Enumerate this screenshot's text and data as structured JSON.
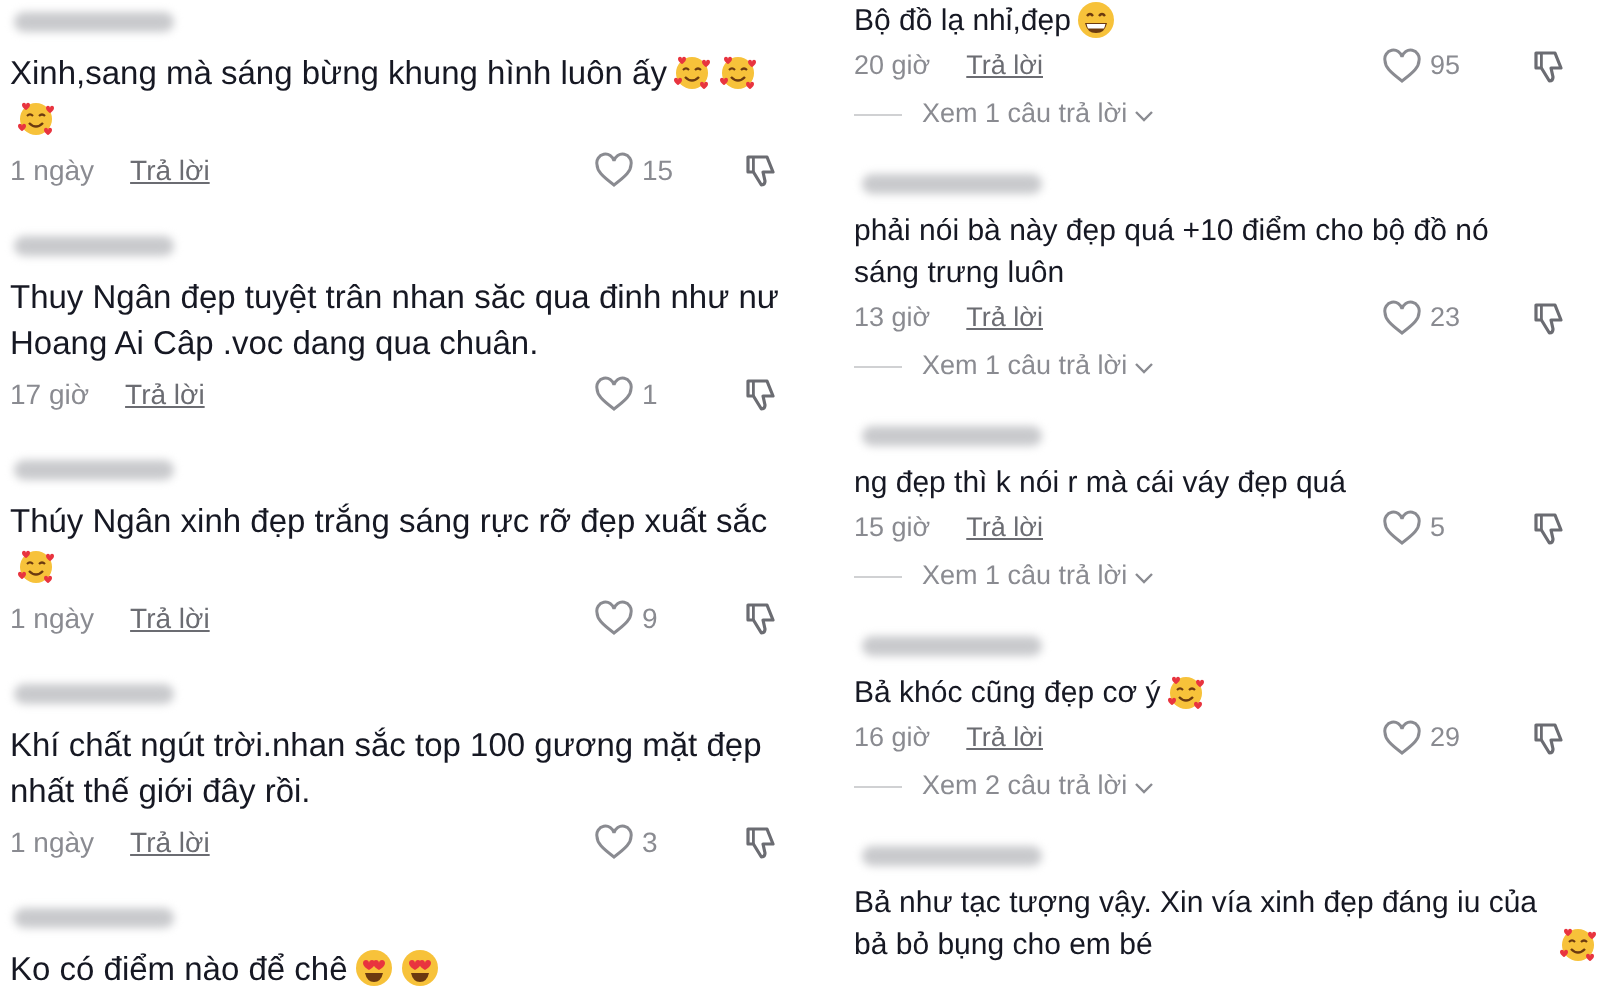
{
  "left_panel": {
    "comments": [
      {
        "author": {
          "blurred": true
        },
        "text": "Xinh,sang mà sáng bừng khung hình luôn ấy",
        "emojis": [
          {
            "kind": "smiling-hearts"
          },
          {
            "kind": "smiling-hearts"
          },
          {
            "kind": "smiling-hearts"
          }
        ],
        "time": "1 ngày",
        "reply_label": "Trả lời",
        "likes": "15"
      },
      {
        "author": {
          "blurred": true
        },
        "text": "Thuy Ngân đẹp tuyệt trân nhan săc qua đinh như nư Hoang Ai Câp .voc dang qua chuân.",
        "time": "17 giờ",
        "reply_label": "Trả lời",
        "likes": "1"
      },
      {
        "author": {
          "blurred": true
        },
        "text": "Thúy Ngân xinh đẹp trắng sáng rực rỡ đẹp xuất sắc",
        "emojis": [
          {
            "kind": "smiling-hearts"
          }
        ],
        "time": "1 ngày",
        "reply_label": "Trả lời",
        "likes": "9"
      },
      {
        "author": {
          "blurred": true
        },
        "text": "Khí chất ngút trời.nhan sắc top 100 gương mặt đẹp nhất thế giới đây rồi.",
        "time": "1 ngày",
        "reply_label": "Trả lời",
        "likes": "3"
      },
      {
        "author": {
          "blurred": true
        },
        "text": "Ko có điểm nào để chê",
        "emojis": [
          {
            "kind": "heart-eyes"
          },
          {
            "kind": "heart-eyes"
          }
        ]
      }
    ]
  },
  "right_panel": {
    "comments": [
      {
        "text": "Bộ đồ lạ nhỉ,đẹp",
        "emojis": [
          {
            "kind": "grin"
          }
        ],
        "time": "20 giờ",
        "reply_label": "Trả lời",
        "likes": "95",
        "view_replies": "Xem 1 câu trả lời"
      },
      {
        "author": {
          "blurred": true
        },
        "text": "phải nói bà này đẹp quá +10 điểm cho bộ đồ nó sáng trưng luôn",
        "time": "13 giờ",
        "reply_label": "Trả lời",
        "likes": "23",
        "view_replies": "Xem 1 câu trả lời"
      },
      {
        "author": {
          "blurred": true
        },
        "text": "ng đẹp thì k nói r mà cái váy đẹp quá",
        "time": "15 giờ",
        "reply_label": "Trả lời",
        "likes": "5",
        "view_replies": "Xem 1 câu trả lời"
      },
      {
        "author": {
          "blurred": true
        },
        "text": "Bả khóc cũng đẹp cơ ý",
        "emojis": [
          {
            "kind": "smiling-hearts"
          }
        ],
        "time": "16 giờ",
        "reply_label": "Trả lời",
        "likes": "29",
        "view_replies": "Xem 2 câu trả lời"
      },
      {
        "author": {
          "blurred": true
        },
        "text": "Bả như tạc tượng vậy. Xin vía xinh đẹp đáng iu của bả bỏ bụng cho em bé",
        "emojis": [
          {
            "kind": "smiling-hearts"
          }
        ]
      }
    ]
  }
}
